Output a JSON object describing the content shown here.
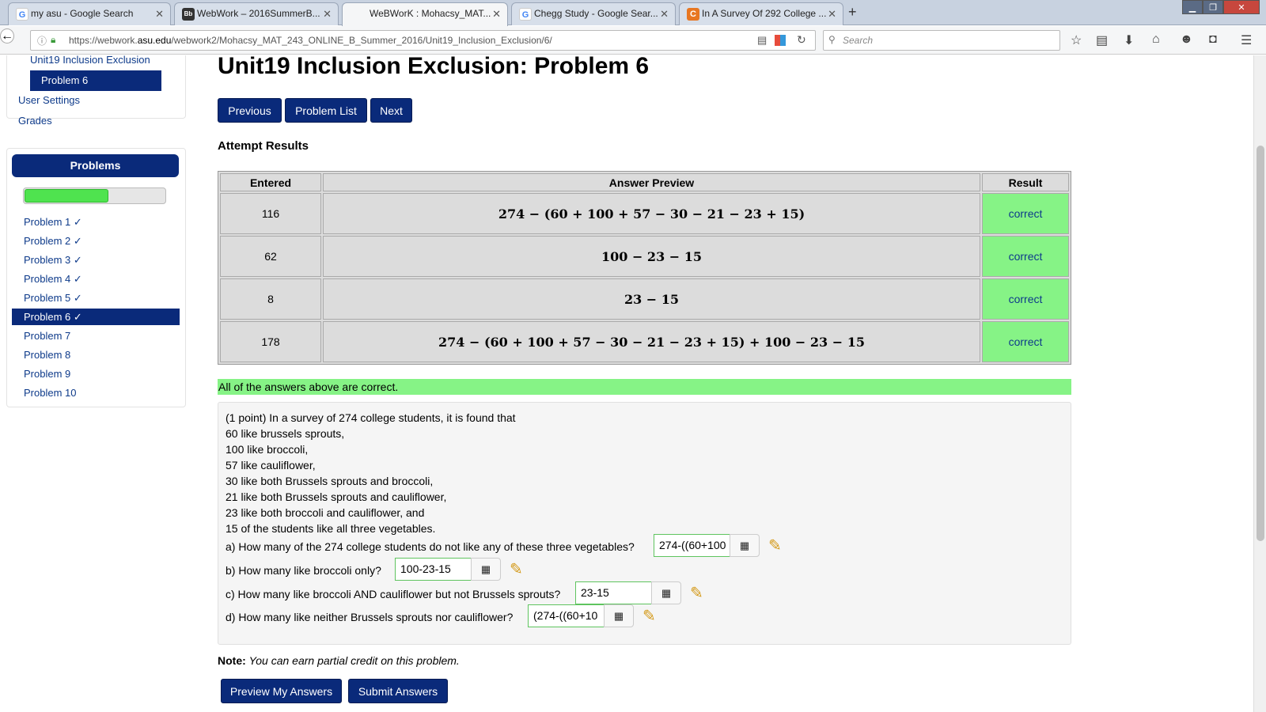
{
  "browser": {
    "tabs": [
      {
        "title": "my asu - Google Search",
        "icon": "google-icon"
      },
      {
        "title": "WebWork – 2016SummerB...",
        "icon": "blackboard-icon"
      },
      {
        "title": "WeBWorK : Mohacsy_MAT...",
        "icon": "none"
      },
      {
        "title": "Chegg Study - Google Sear...",
        "icon": "google-icon"
      },
      {
        "title": "In A Survey Of 292 College ...",
        "icon": "chegg-icon"
      }
    ],
    "url_prefix": "https://webwork.",
    "url_domain": "asu.edu",
    "url_path": "/webwork2/Mohacsy_MAT_243_ONLINE_B_Summer_2016/Unit19_Inclusion_Exclusion/6/",
    "search_placeholder": "Search"
  },
  "sidebar": {
    "unit_link": "Unit19 Inclusion Exclusion",
    "current_problem": "Problem 6",
    "user_settings": "User Settings",
    "grades": "Grades",
    "problems_header": "Problems",
    "progress_fraction": 0.6,
    "problems": [
      {
        "label": "Problem 1 ✓",
        "active": false
      },
      {
        "label": "Problem 2 ✓",
        "active": false
      },
      {
        "label": "Problem 3 ✓",
        "active": false
      },
      {
        "label": "Problem 4 ✓",
        "active": false
      },
      {
        "label": "Problem 5 ✓",
        "active": false
      },
      {
        "label": "Problem 6 ✓",
        "active": true
      },
      {
        "label": "Problem 7",
        "active": false
      },
      {
        "label": "Problem 8",
        "active": false
      },
      {
        "label": "Problem 9",
        "active": false
      },
      {
        "label": "Problem 10",
        "active": false
      }
    ]
  },
  "main": {
    "title": "Unit19 Inclusion Exclusion: Problem 6",
    "buttons": {
      "previous": "Previous",
      "problem_list": "Problem List",
      "next": "Next"
    },
    "attempt_heading": "Attempt Results",
    "table": {
      "headers": [
        "Entered",
        "Answer Preview",
        "Result"
      ],
      "rows": [
        {
          "entered": "116",
          "preview": "274 − (60 + 100 + 57 − 30 − 21 − 23 + 15)",
          "result": "correct"
        },
        {
          "entered": "62",
          "preview": "100 − 23 − 15",
          "result": "correct"
        },
        {
          "entered": "8",
          "preview": "23 − 15",
          "result": "correct"
        },
        {
          "entered": "178",
          "preview": "274 − (60 + 100 + 57 − 30 − 21 − 23 + 15) + 100 − 23 − 15",
          "result": "correct"
        }
      ]
    },
    "all_correct_message": "All of the answers above are correct.",
    "problem": {
      "lines": [
        "(1 point) In a survey of 274 college students, it is found that",
        "60 like brussels sprouts,",
        "100 like broccoli,",
        "57 like cauliflower,",
        "30 like both Brussels sprouts and broccoli,",
        "21 like both Brussels sprouts and cauliflower,",
        "23 like both broccoli and cauliflower, and",
        "15 of the students like all three vegetables."
      ],
      "questions": [
        {
          "label": "a)   How many of the 274 college students do not like any of these three vegetables?",
          "value": "274-((60+100"
        },
        {
          "label": "b)   How many like broccoli only?",
          "value": "100-23-15"
        },
        {
          "label": "c)   How many like broccoli AND cauliflower but not Brussels sprouts?",
          "value": "23-15"
        },
        {
          "label": "d)   How many like neither Brussels sprouts nor cauliflower?",
          "value": "(274-((60+10"
        }
      ]
    },
    "note_label": "Note:",
    "note_text": "You can earn partial credit on this problem.",
    "preview_button": "Preview My Answers",
    "submit_button": "Submit Answers"
  }
}
